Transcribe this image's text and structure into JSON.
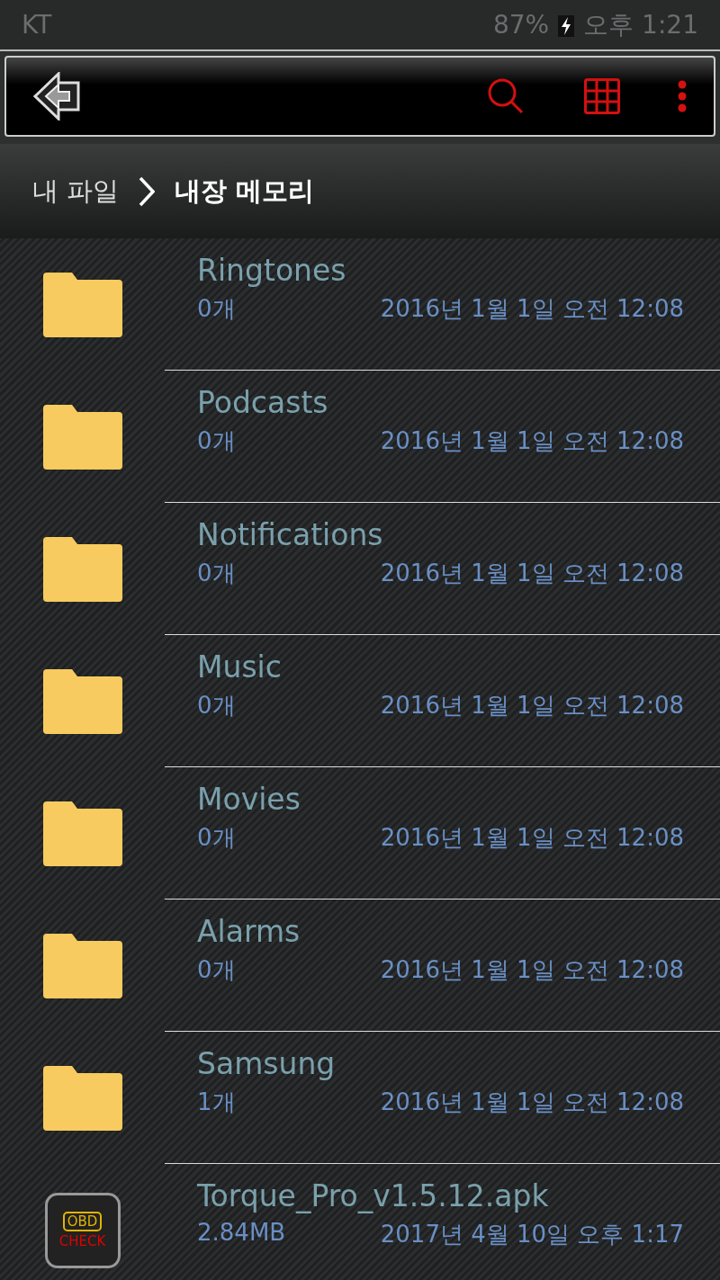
{
  "status_bar": {
    "carrier": "KT",
    "battery": "87%",
    "time": "오후 1:21"
  },
  "breadcrumb": [
    {
      "label": "내 파일",
      "selected": false
    },
    {
      "label": "내장 메모리",
      "selected": true
    }
  ],
  "files": [
    {
      "kind": "folder",
      "name": "Ringtones",
      "size": "0개",
      "date": "2016년 1월 1일 오전 12:08"
    },
    {
      "kind": "folder",
      "name": "Podcasts",
      "size": "0개",
      "date": "2016년 1월 1일 오전 12:08"
    },
    {
      "kind": "folder",
      "name": "Notifications",
      "size": "0개",
      "date": "2016년 1월 1일 오전 12:08"
    },
    {
      "kind": "folder",
      "name": "Music",
      "size": "0개",
      "date": "2016년 1월 1일 오전 12:08"
    },
    {
      "kind": "folder",
      "name": "Movies",
      "size": "0개",
      "date": "2016년 1월 1일 오전 12:08"
    },
    {
      "kind": "folder",
      "name": "Alarms",
      "size": "0개",
      "date": "2016년 1월 1일 오전 12:08"
    },
    {
      "kind": "folder",
      "name": "Samsung",
      "size": "1개",
      "date": "2016년 1월 1일 오전 12:08"
    },
    {
      "kind": "apk",
      "name": "Torque_Pro_v1.5.12.apk",
      "size": "2.84MB",
      "date": "2017년 4월 10일 오후 1:17",
      "icon_text": [
        "OBD",
        "CHECK"
      ]
    }
  ]
}
